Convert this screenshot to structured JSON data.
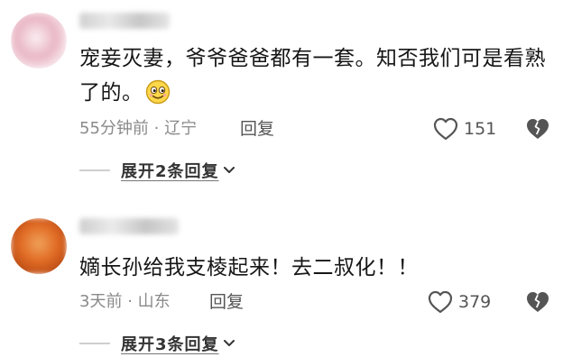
{
  "comments": [
    {
      "content": "宠妾灭妻，爷爷爸爸都有一套。知否我们可是看熟了的。",
      "emoji": "smiling-face-emoji",
      "time": "55分钟前",
      "separator": "·",
      "location": "辽宁",
      "reply_label": "回复",
      "likes": "151",
      "expand_label": "展开2条回复",
      "avatar_colors": [
        "#f3dfe6",
        "#d79aab",
        "#fbeff3"
      ]
    },
    {
      "content": "嫡长孙给我支棱起来！去二叔化！！",
      "time": "3天前",
      "separator": "·",
      "location": "山东",
      "reply_label": "回复",
      "likes": "379",
      "expand_label": "展开3条回复",
      "avatar_colors": [
        "#e06a24",
        "#f0a25a",
        "#b84a14"
      ]
    }
  ],
  "icons": {
    "like": "heart-outline-icon",
    "dislike": "broken-heart-icon",
    "expand": "chevron-down-icon"
  },
  "colors": {
    "text": "#161616",
    "meta": "#8a8a8a",
    "icon": "#555555"
  }
}
